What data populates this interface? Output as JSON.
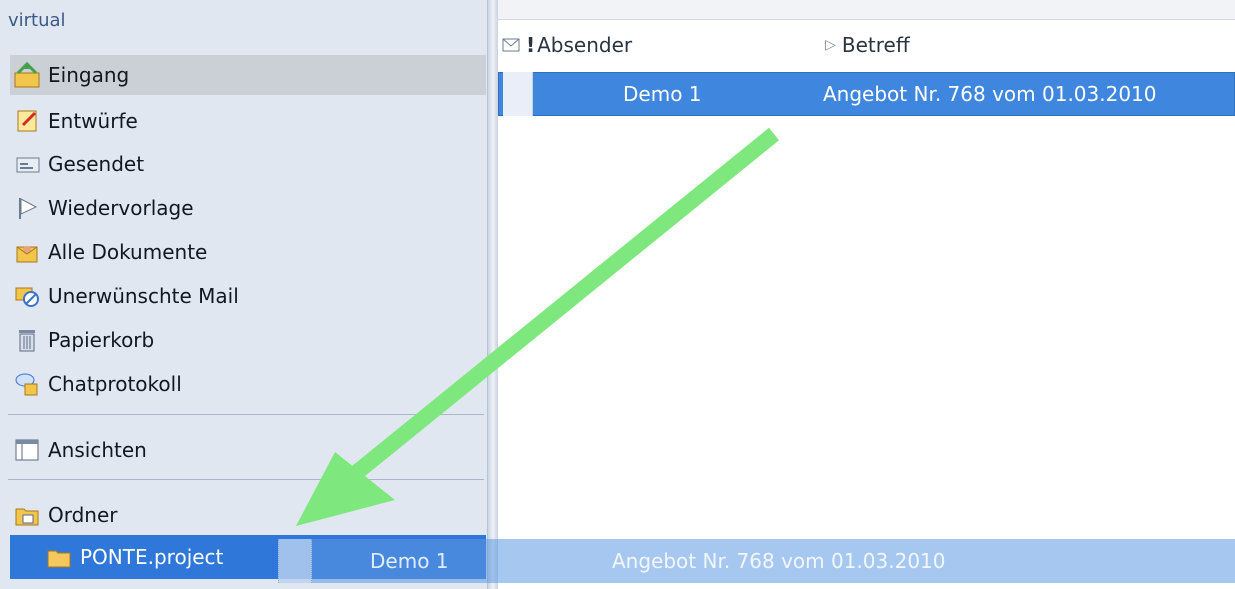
{
  "sidebar": {
    "title": "virtual",
    "items": [
      {
        "label": "Eingang",
        "icon": "inbox-icon",
        "selected": true
      },
      {
        "label": "Entwürfe",
        "icon": "drafts-icon"
      },
      {
        "label": "Gesendet",
        "icon": "sent-icon"
      },
      {
        "label": "Wiedervorlage",
        "icon": "followup-flag-icon"
      },
      {
        "label": "Alle Dokumente",
        "icon": "all-documents-icon"
      },
      {
        "label": "Unerwünschte Mail",
        "icon": "junk-mail-icon"
      },
      {
        "label": "Papierkorb",
        "icon": "trash-icon"
      },
      {
        "label": "Chatprotokoll",
        "icon": "chat-log-icon"
      }
    ],
    "views": {
      "label": "Ansichten",
      "icon": "views-icon"
    },
    "folders": {
      "label": "Ordner",
      "icon": "folders-icon"
    },
    "folder_active": {
      "label": "PONTE.project",
      "icon": "folder-icon"
    }
  },
  "list": {
    "header": {
      "sender": "Absender",
      "subject": "Betreff",
      "icons": [
        "envelope-icon",
        "importance-icon",
        "sort-triangle-icon"
      ]
    },
    "rows": [
      {
        "sender": "Demo 1",
        "subject": "Angebot Nr. 768 vom 01.03.2010",
        "selected": true
      }
    ]
  },
  "drag": {
    "sender": "Demo 1",
    "subject": "Angebot Nr. 768 vom 01.03.2010"
  },
  "colors": {
    "arrow": "#7ee87e",
    "selection": "#3f86de",
    "sidebar_bg": "#e1e7f1"
  }
}
